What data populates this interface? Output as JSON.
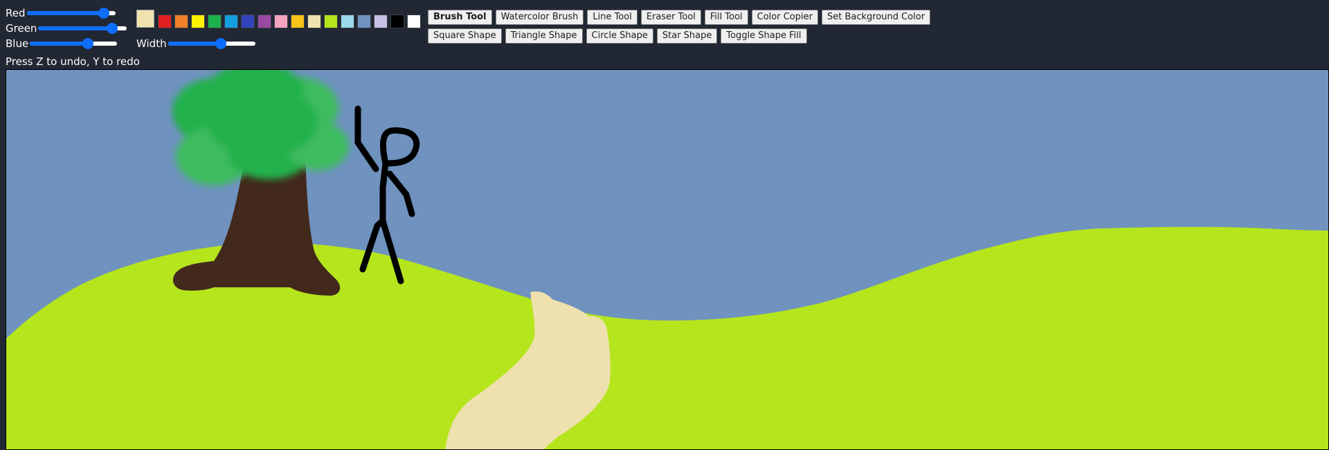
{
  "sliders": {
    "red": {
      "label": "Red",
      "value": 235,
      "max": 255
    },
    "green": {
      "label": "Green",
      "value": 225,
      "max": 255
    },
    "blue": {
      "label": "Blue",
      "value": 175,
      "max": 255
    },
    "width": {
      "label": "Width",
      "value": 62,
      "max": 100
    }
  },
  "current_color": "#F0E2AE",
  "palette": [
    {
      "name": "red",
      "color": "#E02020"
    },
    {
      "name": "orange",
      "color": "#F0802A"
    },
    {
      "name": "yellow",
      "color": "#FFF200"
    },
    {
      "name": "green",
      "color": "#1DB14B"
    },
    {
      "name": "sky-blue",
      "color": "#14A0E0"
    },
    {
      "name": "blue",
      "color": "#3344BB"
    },
    {
      "name": "purple",
      "color": "#9A4AA2"
    },
    {
      "name": "pink",
      "color": "#F5A4C0"
    },
    {
      "name": "gold",
      "color": "#F7C219"
    },
    {
      "name": "tan",
      "color": "#F0E2AE"
    },
    {
      "name": "lime",
      "color": "#B4E41C"
    },
    {
      "name": "light-blue",
      "color": "#9AD9EA"
    },
    {
      "name": "steel-blue",
      "color": "#7092BE"
    },
    {
      "name": "lavender",
      "color": "#C8BFE7"
    },
    {
      "name": "black",
      "color": "#000000"
    },
    {
      "name": "white",
      "color": "#FFFFFF"
    }
  ],
  "tools": [
    {
      "name": "brush-tool-button",
      "label": "Brush Tool",
      "active": true
    },
    {
      "name": "watercolor-brush-button",
      "label": "Watercolor Brush"
    },
    {
      "name": "line-tool-button",
      "label": "Line Tool"
    },
    {
      "name": "eraser-tool-button",
      "label": "Eraser Tool"
    },
    {
      "name": "fill-tool-button",
      "label": "Fill Tool"
    },
    {
      "name": "color-copier-button",
      "label": "Color Copier"
    },
    {
      "name": "set-background-color-button",
      "label": "Set Background Color"
    }
  ],
  "shapes": [
    {
      "name": "square-shape-button",
      "label": "Square Shape"
    },
    {
      "name": "triangle-shape-button",
      "label": "Triangle Shape"
    },
    {
      "name": "circle-shape-button",
      "label": "Circle Shape"
    },
    {
      "name": "star-shape-button",
      "label": "Star Shape"
    },
    {
      "name": "toggle-shape-fill-button",
      "label": "Toggle Shape Fill"
    }
  ],
  "hint": "Press Z to undo, Y to redo",
  "drawing_colors": {
    "sky": "#6F92BF",
    "grass": "#B5E51D",
    "trunk": "#42291C",
    "foliage": "#22B14C",
    "foliage_light": "#3DBB5E",
    "path": "#EEE1AE",
    "stick_figure": "#000000"
  }
}
